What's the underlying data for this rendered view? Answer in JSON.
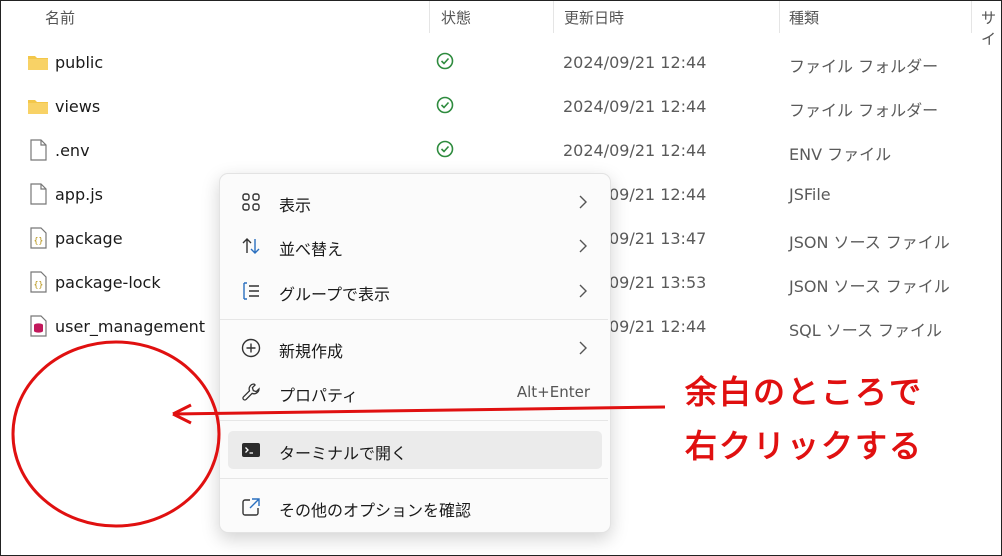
{
  "columns": {
    "name": "名前",
    "status": "状態",
    "modified": "更新日時",
    "type": "種類",
    "size": "サイ"
  },
  "files": [
    {
      "name": "public",
      "status_icon": "synced-check-icon",
      "date": "2024/09/21 12:44",
      "type": "ファイル フォルダー",
      "icon": "folder-icon"
    },
    {
      "name": "views",
      "status_icon": "synced-check-icon",
      "date": "2024/09/21 12:44",
      "type": "ファイル フォルダー",
      "icon": "folder-icon"
    },
    {
      "name": ".env",
      "status_icon": "synced-check-icon",
      "date": "2024/09/21 12:44",
      "type": "ENV ファイル",
      "icon": "file-icon"
    },
    {
      "name": "app.js",
      "date": "09/21 12:44",
      "type": "JSFile",
      "icon": "file-icon"
    },
    {
      "name": "package",
      "date": "09/21 13:47",
      "type": "JSON ソース ファイル",
      "icon": "json-file-icon"
    },
    {
      "name": "package-lock",
      "date": "09/21 13:53",
      "type": "JSON ソース ファイル",
      "icon": "json-file-icon"
    },
    {
      "name": "user_management",
      "date": "09/21 12:44",
      "type": "SQL ソース ファイル",
      "icon": "sql-file-icon"
    }
  ],
  "menu": {
    "view": "表示",
    "sort": "並べ替え",
    "group": "グループで表示",
    "new": "新規作成",
    "properties": "プロパティ",
    "properties_shortcut": "Alt+Enter",
    "terminal": "ターミナルで開く",
    "more_options": "その他のオプションを確認"
  },
  "annotation": {
    "line1": "余白のところで",
    "line2": "右クリックする",
    "color": "#e01010"
  },
  "colors": {
    "status_green": "#2e8b3e",
    "folder_yellow": "#f3c74a",
    "menu_icon_blue": "#2a6fbf"
  }
}
